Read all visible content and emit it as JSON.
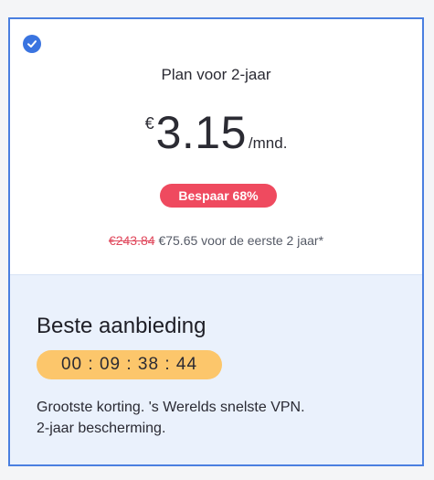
{
  "colors": {
    "accent": "#3a74e0",
    "badge": "#ef4a5f",
    "timer": "#fcc66b",
    "offer_bg": "#eaf1fc"
  },
  "plan": {
    "selected_icon": "check-circle-icon",
    "title": "Plan voor 2-jaar",
    "currency": "€",
    "price": "3.15",
    "per": "/mnd.",
    "badge": "Bespaar 68%",
    "old_price": "€243.84",
    "new_price_text": "€75.65 voor de eerste 2 jaar*"
  },
  "offer": {
    "title": "Beste aanbieding",
    "timer": "00 : 09 : 38 : 44",
    "line1": "Grootste korting. 's Werelds snelste VPN.",
    "line2": "2-jaar bescherming."
  }
}
